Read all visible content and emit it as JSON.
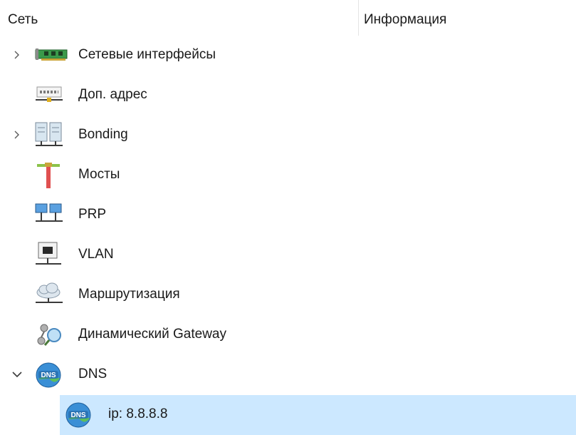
{
  "columns": {
    "network": "Сеть",
    "info": "Информация"
  },
  "tree": {
    "items": [
      {
        "label": "Сетевые интерфейсы",
        "icon": "network-card-icon",
        "expander": "collapsed"
      },
      {
        "label": "Доп. адрес",
        "icon": "ip-address-icon",
        "expander": "none"
      },
      {
        "label": "Bonding",
        "icon": "bonding-servers-icon",
        "expander": "collapsed"
      },
      {
        "label": "Мосты",
        "icon": "bridge-icon",
        "expander": "none"
      },
      {
        "label": "PRP",
        "icon": "prp-network-icon",
        "expander": "none"
      },
      {
        "label": "VLAN",
        "icon": "vlan-icon",
        "expander": "none"
      },
      {
        "label": "Маршрутизация",
        "icon": "routing-cloud-icon",
        "expander": "none"
      },
      {
        "label": "Динамический Gateway",
        "icon": "dynamic-gateway-icon",
        "expander": "none"
      },
      {
        "label": "DNS",
        "icon": "dns-globe-icon",
        "expander": "expanded"
      }
    ],
    "dns_child": {
      "label": "ip: 8.8.8.8",
      "icon": "dns-globe-icon",
      "selected": true
    }
  },
  "colors": {
    "selection": "#cce8ff",
    "chevron": "#5a5a5a"
  }
}
